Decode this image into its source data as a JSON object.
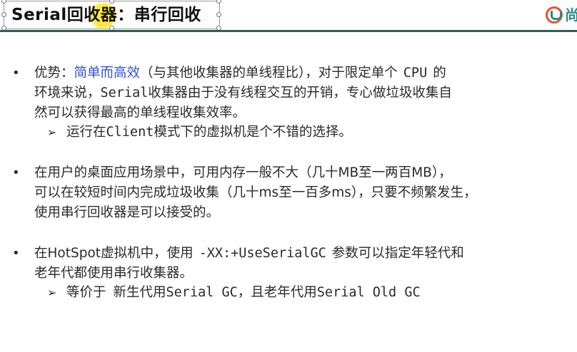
{
  "title": {
    "part1": "Serial回收器",
    "part2": "：串行回收"
  },
  "logo": {
    "text": "尚"
  },
  "bullets": [
    {
      "symbol": "•",
      "line1_prefix": "优势：",
      "line1_highlight": "简单而高效",
      "line1_rest": "（与其他收集器的单线程比），对于限定单个",
      "line1_cpu": "CPU",
      "line1_end": "的",
      "line2_a": "环境来说，",
      "line2_b": "Serial",
      "line2_c": "收集器由于没有线程交互的开销，专心做垃圾收集自",
      "line3": "然可以获得最高的单线程收集效率。",
      "sub_arrow": "➢",
      "sub_a": "运行在",
      "sub_b": "Client",
      "sub_c": "模式下的虚拟机是个不错的选择。"
    },
    {
      "symbol": "•",
      "line1_a": "在用户的桌面应用场景中，可用内存一般不大（几十",
      "line1_b": "MB",
      "line1_c": "至一两百",
      "line1_d": "MB",
      "line1_e": "），",
      "line2_a": "可以在较短时间内完成垃圾收集（几十",
      "line2_b": "ms",
      "line2_c": "至一百多",
      "line2_d": "ms",
      "line2_e": "），只要不频繁发生，",
      "line3": "使用串行回收器是可以接受的。"
    },
    {
      "symbol": "•",
      "line1_a": "在",
      "line1_b": "HotSpot",
      "line1_c": "虚拟机中，使用",
      "line1_d": "-XX:+UseSerialGC",
      "line1_e": "参数可以指定年轻代和",
      "line2": "老年代都使用串行收集器。",
      "sub_arrow": "➢",
      "sub_a": "等价于",
      "sub_b": "新生代用",
      "sub_c": "Serial GC",
      "sub_d": "，且老年代用",
      "sub_e": "Serial Old GC"
    }
  ]
}
